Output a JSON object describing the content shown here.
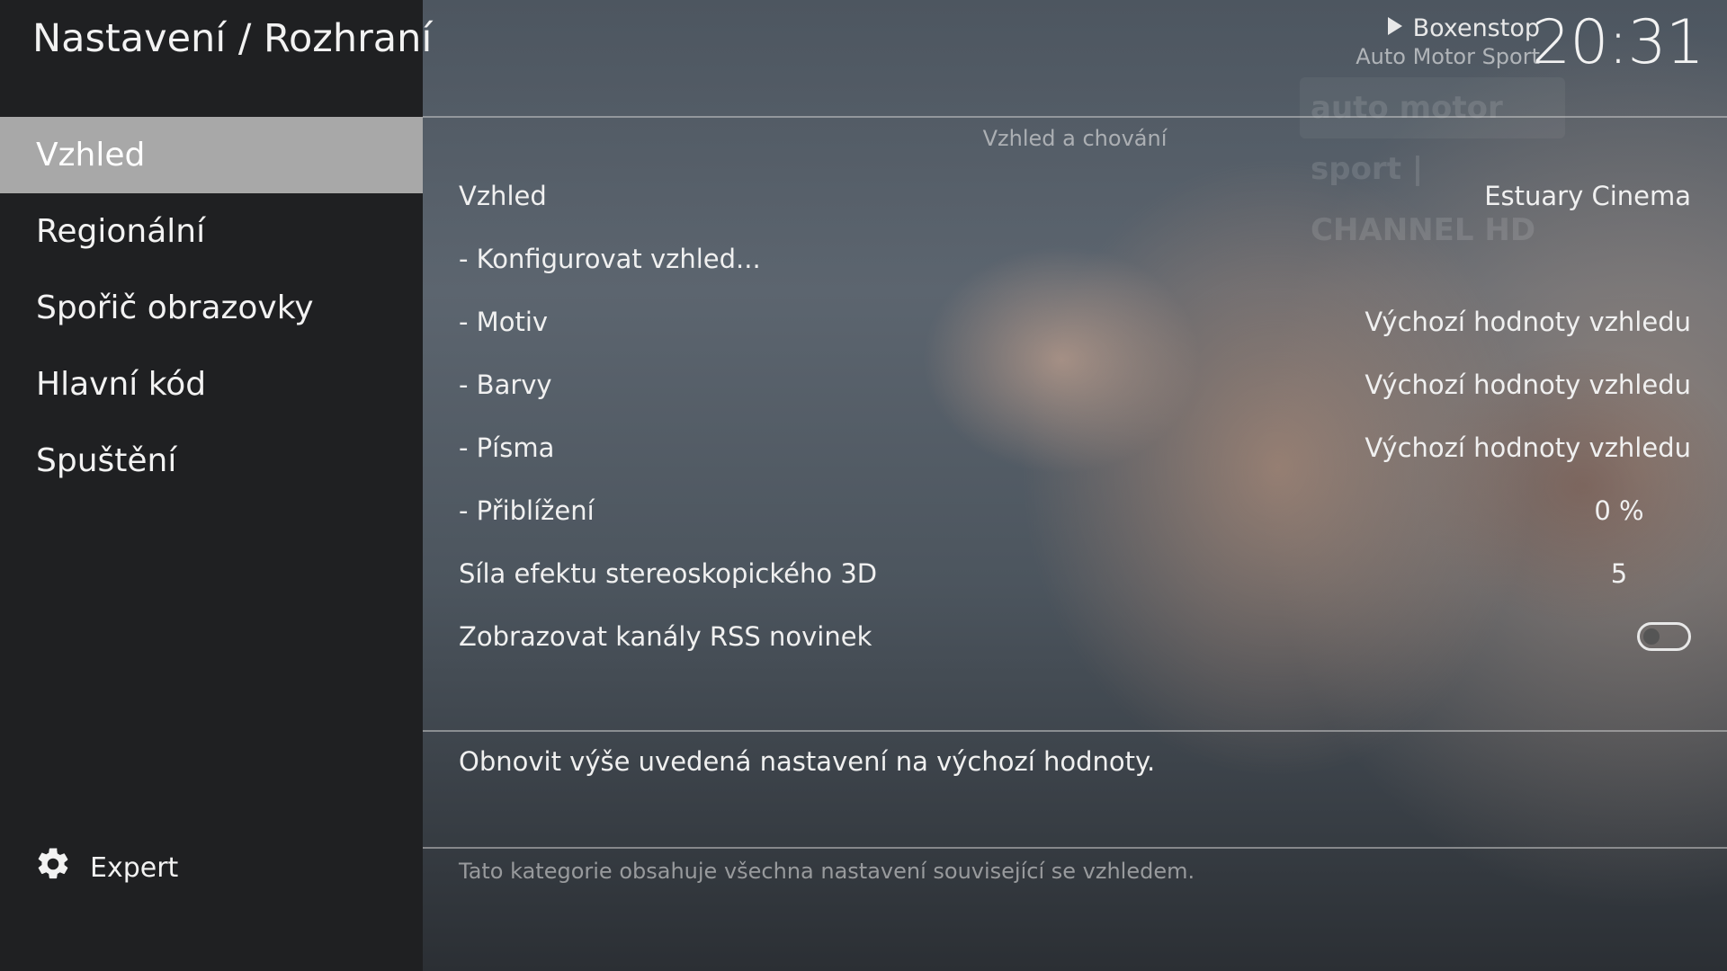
{
  "header": {
    "title": "Nastavení / Rozhraní",
    "now_playing_title": "Boxenstop",
    "now_playing_channel": "Auto Motor Sport",
    "clock": "20:31"
  },
  "sidebar": {
    "items": [
      {
        "label": "Vzhled",
        "active": true
      },
      {
        "label": "Regionální"
      },
      {
        "label": "Spořič obrazovky"
      },
      {
        "label": "Hlavní kód"
      },
      {
        "label": "Spuštění"
      }
    ],
    "level_label": "Expert"
  },
  "main": {
    "section_title": "Vzhled a chování",
    "settings": [
      {
        "label": "Vzhled",
        "value": "Estuary Cinema"
      },
      {
        "label": "- Konfigurovat vzhled...",
        "value": ""
      },
      {
        "label": "- Motiv",
        "value": "Výchozí hodnoty vzhledu"
      },
      {
        "label": "- Barvy",
        "value": "Výchozí hodnoty vzhledu"
      },
      {
        "label": "- Písma",
        "value": "Výchozí hodnoty vzhledu"
      },
      {
        "label": "- Přiblížení",
        "value": "0 %"
      },
      {
        "label": "Síla efektu stereoskopického 3D",
        "value": "5"
      },
      {
        "label": "Zobrazovat kanály RSS novinek",
        "toggle": false
      }
    ],
    "reset_label": "Obnovit výše uvedená nastavení na výchozí hodnoty.",
    "description": "Tato kategorie obsahuje všechna nastavení související se vzhledem."
  },
  "icons": {
    "play": "play-icon",
    "gear": "gear-icon"
  }
}
